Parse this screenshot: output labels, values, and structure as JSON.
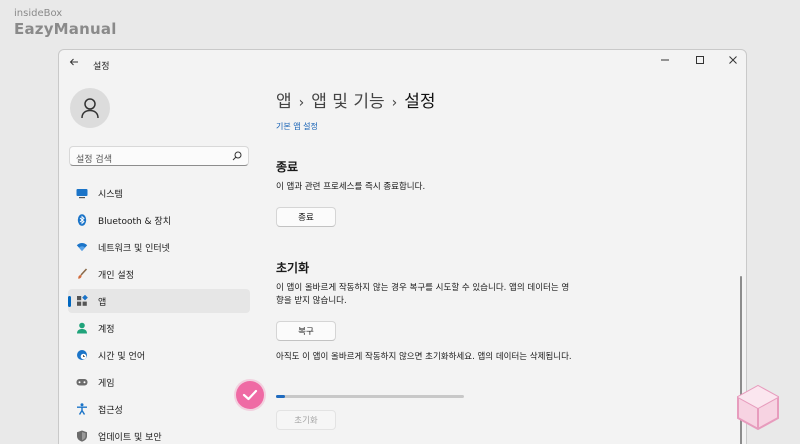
{
  "brand": {
    "line1": "insideBox",
    "line2": "EazyManual"
  },
  "window": {
    "title": "설정"
  },
  "sidebar": {
    "search_placeholder": "설정 검색",
    "items": [
      {
        "label": "시스템",
        "icon": "monitor-icon"
      },
      {
        "label": "Bluetooth & 장치",
        "icon": "bluetooth-icon"
      },
      {
        "label": "네트워크 및 인터넷",
        "icon": "wifi-icon"
      },
      {
        "label": "개인 설정",
        "icon": "brush-icon"
      },
      {
        "label": "앱",
        "icon": "apps-icon",
        "selected": true
      },
      {
        "label": "계정",
        "icon": "person-icon"
      },
      {
        "label": "시간 및 언어",
        "icon": "globe-clock-icon"
      },
      {
        "label": "게임",
        "icon": "gamepad-icon"
      },
      {
        "label": "접근성",
        "icon": "accessibility-icon"
      },
      {
        "label": "업데이트 및 보안",
        "icon": "shield-icon"
      }
    ]
  },
  "main": {
    "breadcrumb": [
      "앱",
      "앱 및 기능",
      "설정"
    ],
    "default_app_link": "기본 앱 설정",
    "terminate": {
      "title": "종료",
      "desc": "이 앱과 관련 프로세스를 즉시 종료합니다.",
      "button": "종료"
    },
    "reset": {
      "title": "초기화",
      "repair_desc": "이 앱이 올바르게 작동하지 않는 경우 복구를 시도할 수 있습니다. 앱의 데이터는 영향을 받지 않습니다.",
      "repair_button": "복구",
      "reset_desc": "아직도 이 앱이 올바르게 작동하지 않으면 초기화하세요. 앱의 데이터는 삭제됩니다.",
      "progress_fraction": 0.05,
      "reset_button": "초기화"
    }
  },
  "colors": {
    "accent": "#0067c0",
    "badge": "#ef6aa4"
  }
}
